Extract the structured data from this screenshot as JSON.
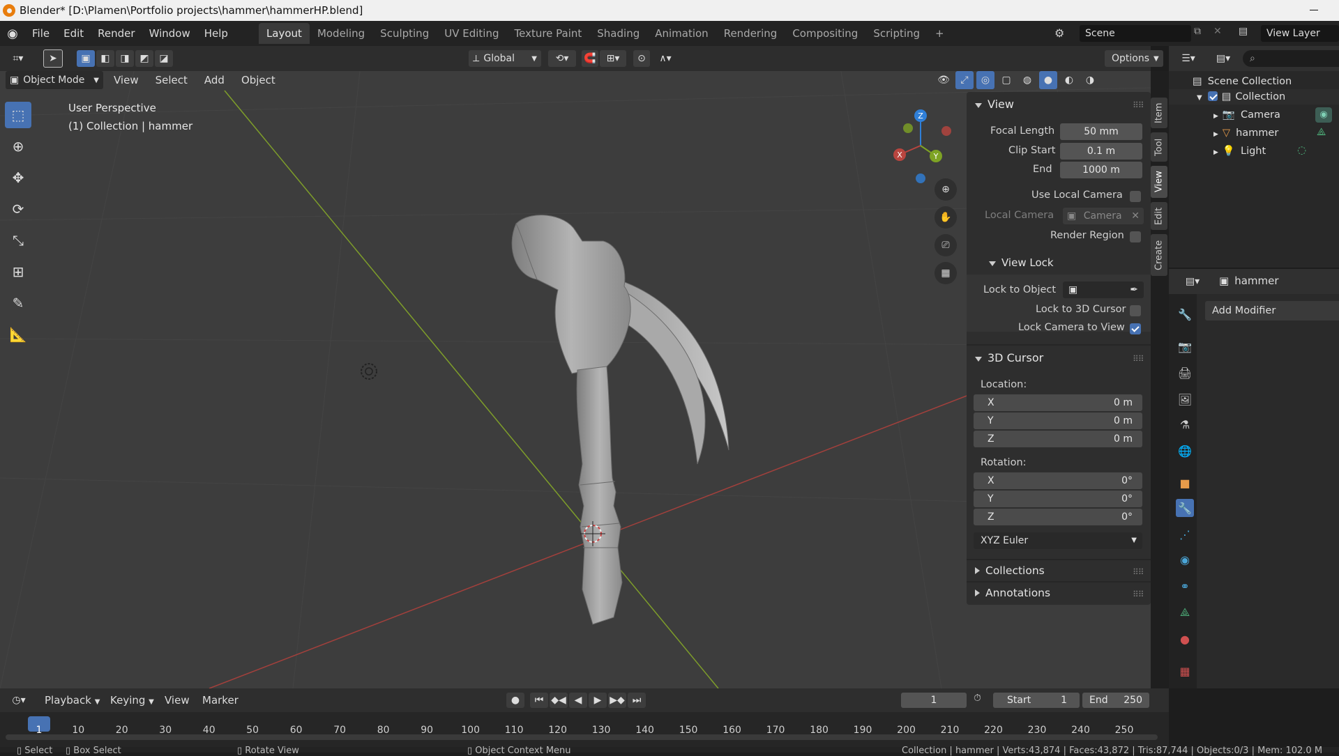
{
  "window": {
    "title": "Blender* [D:\\Plamen\\Portfolio projects\\hammer\\hammerHP.blend]"
  },
  "menu": {
    "items": [
      "File",
      "Edit",
      "Render",
      "Window",
      "Help"
    ]
  },
  "workspaces": {
    "tabs": [
      "Layout",
      "Modeling",
      "Sculpting",
      "UV Editing",
      "Texture Paint",
      "Shading",
      "Animation",
      "Rendering",
      "Compositing",
      "Scripting"
    ],
    "add": "+"
  },
  "scene": {
    "name": "Scene",
    "view_layer": "View Layer"
  },
  "header": {
    "orientation": "Global",
    "options": "Options"
  },
  "viewport": {
    "mode": "Object Mode",
    "menus": [
      "View",
      "Select",
      "Add",
      "Object"
    ],
    "overlay_line1": "User Perspective",
    "overlay_line2": "(1) Collection | hammer",
    "gizmo": {
      "x": "X",
      "y": "Y",
      "z": "Z"
    }
  },
  "npanel": {
    "tabs": [
      "Item",
      "Tool",
      "View",
      "Edit",
      "Create"
    ],
    "view": {
      "title": "View",
      "focal_label": "Focal Length",
      "focal_value": "50 mm",
      "clip_start_label": "Clip Start",
      "clip_start_value": "0.1 m",
      "end_label": "End",
      "end_value": "1000 m",
      "use_local_camera": "Use Local Camera",
      "local_camera_label": "Local Camera",
      "local_camera_value": "Camera",
      "render_region": "Render Region"
    },
    "view_lock": {
      "title": "View Lock",
      "lock_object": "Lock to Object",
      "lock_cursor": "Lock to 3D Cursor",
      "lock_camera": "Lock Camera to View",
      "lock_camera_checked": true
    },
    "cursor": {
      "title": "3D Cursor",
      "location": "Location:",
      "loc": [
        {
          "axis": "X",
          "value": "0 m"
        },
        {
          "axis": "Y",
          "value": "0 m"
        },
        {
          "axis": "Z",
          "value": "0 m"
        }
      ],
      "rotation": "Rotation:",
      "rot": [
        {
          "axis": "X",
          "value": "0°"
        },
        {
          "axis": "Y",
          "value": "0°"
        },
        {
          "axis": "Z",
          "value": "0°"
        }
      ],
      "mode": "XYZ Euler"
    },
    "collections": "Collections",
    "annotations": "Annotations"
  },
  "outliner": {
    "root": "Scene Collection",
    "collection": "Collection",
    "items": [
      "Camera",
      "hammer",
      "Light"
    ]
  },
  "properties": {
    "object": "hammer",
    "add_modifier": "Add Modifier"
  },
  "timeline": {
    "menus": [
      "Playback",
      "Keying",
      "View",
      "Marker"
    ],
    "current_frame": "1",
    "start_label": "Start",
    "start": "1",
    "end_label": "End",
    "end": "250",
    "ticks": [
      "1",
      "10",
      "20",
      "30",
      "40",
      "50",
      "60",
      "70",
      "80",
      "90",
      "100",
      "110",
      "120",
      "130",
      "140",
      "150",
      "160",
      "170",
      "180",
      "190",
      "200",
      "210",
      "220",
      "230",
      "240",
      "250"
    ]
  },
  "statusbar": {
    "select": "Select",
    "box_select": "Box Select",
    "rotate": "Rotate View",
    "context": "Object Context Menu",
    "stats": "Collection | hammer | Verts:43,874 | Faces:43,872 | Tris:87,744 | Objects:0/3 | Mem: 102.0 M"
  },
  "colors": {
    "accent": "#4772b3",
    "x_axis": "#b9453f",
    "y_axis": "#7ea324",
    "z_axis": "#2f7fd8"
  }
}
